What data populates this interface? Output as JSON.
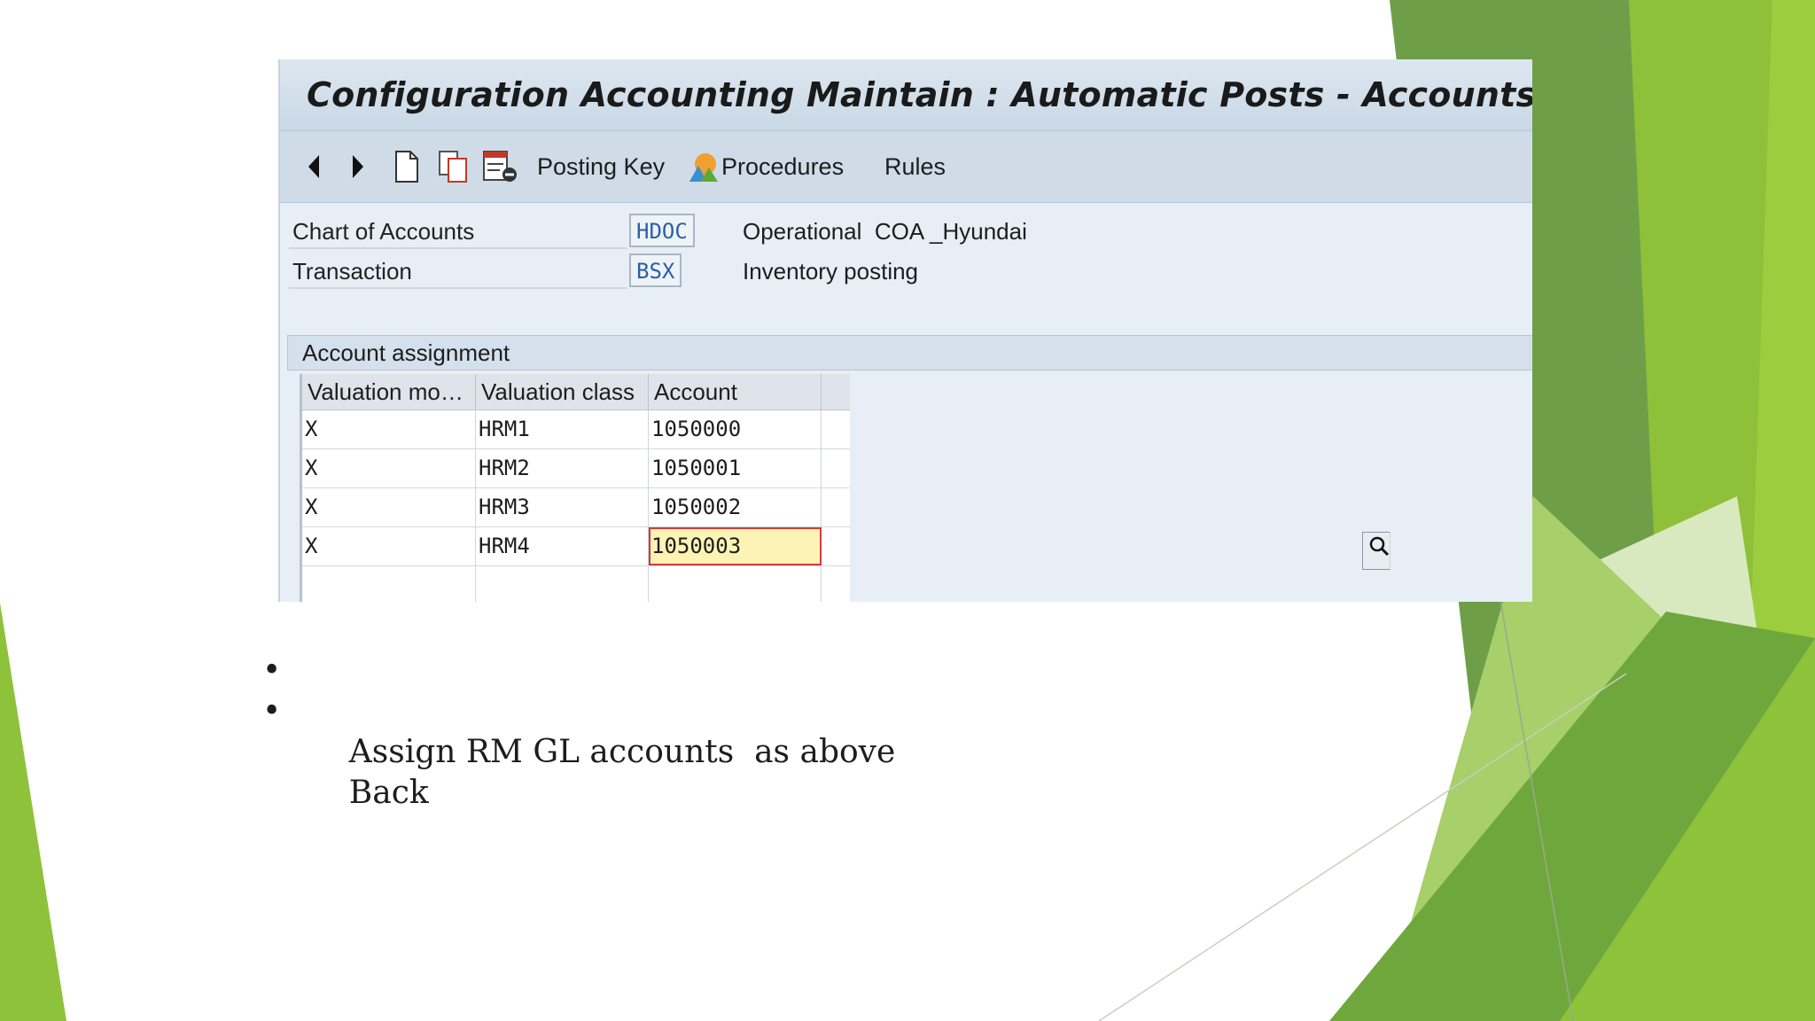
{
  "window": {
    "title": "Configuration Accounting Maintain : Automatic Posts - Accounts"
  },
  "toolbar": {
    "icons": [
      "triangle-left-icon",
      "triangle-right-icon",
      "new-document-icon",
      "copy-icon",
      "delete-icon",
      "procedures-icon"
    ],
    "posting_key": "Posting Key",
    "procedures": "Procedures",
    "rules": "Rules"
  },
  "fields": {
    "chart_of_accounts": {
      "label": "Chart of Accounts",
      "value": "HDOC",
      "description": "Operational  COA _Hyundai"
    },
    "transaction": {
      "label": "Transaction",
      "value": "BSX",
      "description": "Inventory posting"
    }
  },
  "account_assignment": {
    "title": "Account assignment",
    "columns": [
      "Valuation mo…",
      "Valuation class",
      "Account"
    ],
    "rows": [
      [
        "X",
        "HRM1",
        "1050000"
      ],
      [
        "X",
        "HRM2",
        "1050001"
      ],
      [
        "X",
        "HRM3",
        "1050002"
      ],
      [
        "X",
        "HRM4",
        "1050003"
      ]
    ]
  },
  "slide": {
    "bullets": [
      "Assign RM GL accounts  as above",
      "Back"
    ],
    "bullet_char": "•",
    "accent_colors": [
      "#9bc23c",
      "#6fa24a",
      "#4e8a2e",
      "#c8dea2",
      "#e3eed0"
    ]
  }
}
